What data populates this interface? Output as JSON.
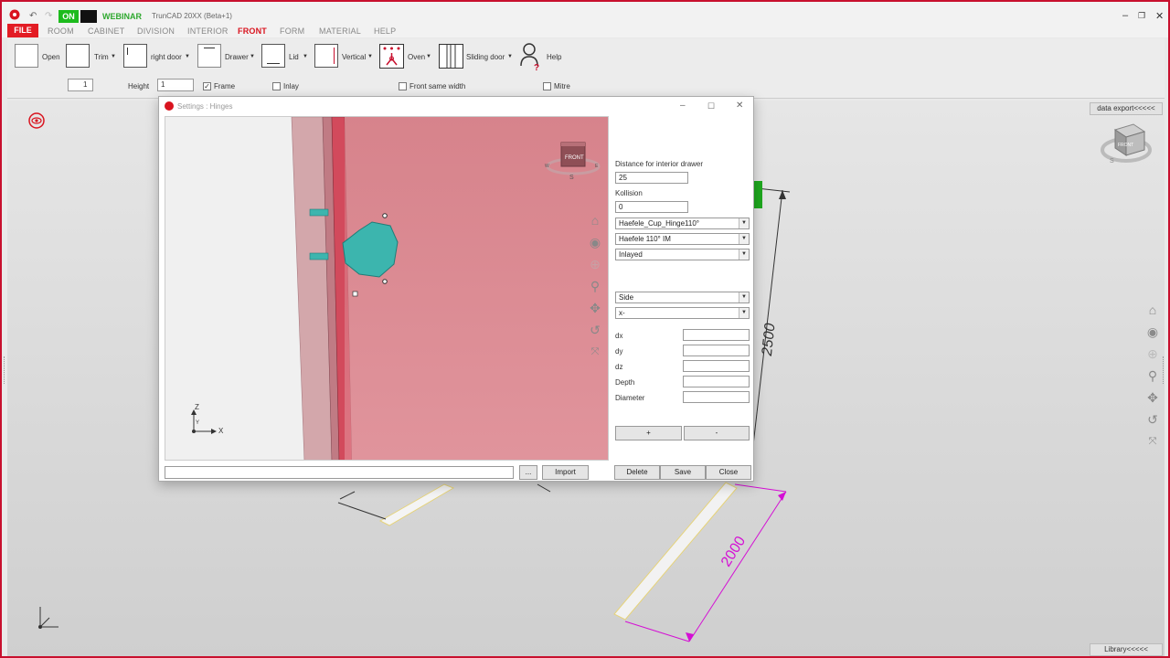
{
  "titlebar": {
    "on_label": "ON",
    "webinar_label": "WEBINAR",
    "app_title": "TrunCAD 20XX (Beta+1)"
  },
  "menu": {
    "file": "FILE",
    "room": "ROOM",
    "cabinet": "CABINET",
    "division": "DIVISION",
    "interior": "INTERIOR",
    "front": "FRONT",
    "form": "FORM",
    "material": "MATERIAL",
    "help": "HELP"
  },
  "ribbon": {
    "open": "Open",
    "trim": "Trim",
    "right_door": "right door",
    "drawer": "Drawer",
    "lid": "Lid",
    "vertical": "Vertical",
    "oven": "Oven",
    "sliding_door": "Sliding door",
    "help": "Help",
    "count_value": "1",
    "height_label": "Height",
    "height_value": "1",
    "frame_label": "Frame",
    "inlay_label": "Inlay",
    "front_same_width_label": "Front same width",
    "mitre_label": "Mitre"
  },
  "viewport": {
    "data_export": "data export<<<<<",
    "library": "Library<<<<<",
    "dim_height": "2500",
    "dim_width": "2000",
    "cube_face": "FRONT",
    "cube_south": "S"
  },
  "dialog": {
    "title": "Settings : Hinges",
    "preview_cube_face": "FRONT",
    "preview_cube_south": "S",
    "preview_cube_west": "W",
    "preview_cube_east": "E",
    "axis_z": "Z",
    "axis_y": "Y",
    "axis_x": "X",
    "distance_label": "Distance for interior drawer",
    "distance_value": "25",
    "kollision_label": "Kollision",
    "kollision_value": "0",
    "hinge_select": "Haefele_Cup_Hinge110°",
    "hinge_type_select": "Haefele 110° IM",
    "mount_select": "Inlayed",
    "side_select": "Side",
    "axis_select": "x-",
    "dx_label": "dx",
    "dy_label": "dy",
    "dz_label": "dz",
    "depth_label": "Depth",
    "diameter_label": "Diameter",
    "plus_label": "+",
    "minus_label": "-",
    "browse_label": "...",
    "import_label": "Import",
    "delete_label": "Delete",
    "save_label": "Save",
    "close_label": "Close"
  },
  "colors": {
    "brand_red": "#d9141f",
    "on_green": "#1dbb1d",
    "door_pink": "#d98890",
    "hinge_teal": "#3cb5ae",
    "dimension_magenta": "#d40fd4"
  }
}
